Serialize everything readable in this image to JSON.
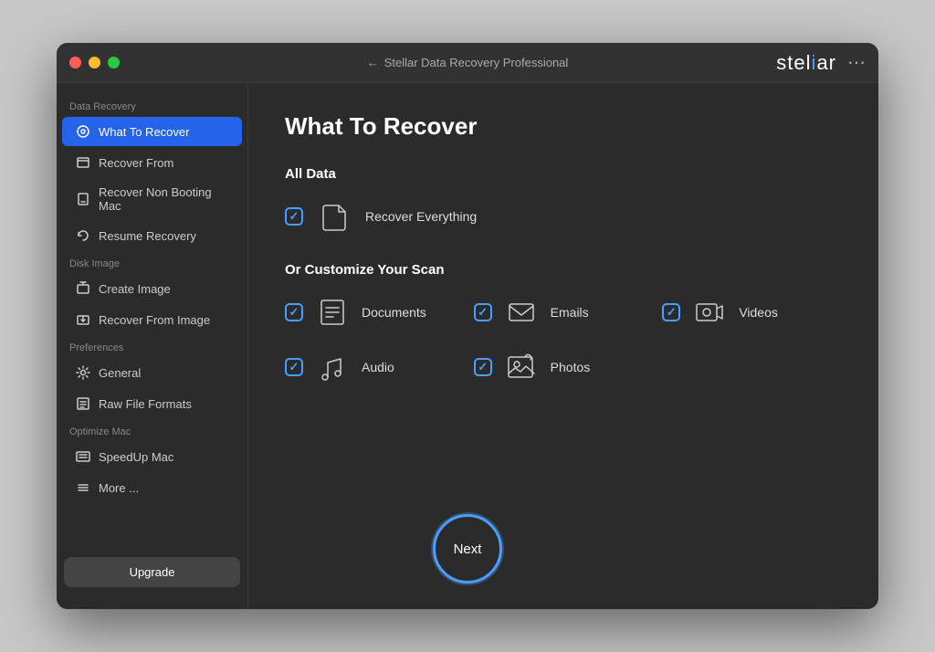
{
  "app": {
    "title": "Stellar Data Recovery Professional",
    "logo": "stellar",
    "logo_accent": "i"
  },
  "titlebar": {
    "back_icon": "←",
    "menu_icon": "⋯"
  },
  "sidebar": {
    "sections": [
      {
        "label": "Data Recovery",
        "items": [
          {
            "id": "what-to-recover",
            "label": "What To Recover",
            "active": true
          },
          {
            "id": "recover-from",
            "label": "Recover From",
            "active": false
          },
          {
            "id": "recover-non-booting",
            "label": "Recover Non Booting Mac",
            "active": false
          },
          {
            "id": "resume-recovery",
            "label": "Resume Recovery",
            "active": false
          }
        ]
      },
      {
        "label": "Disk Image",
        "items": [
          {
            "id": "create-image",
            "label": "Create Image",
            "active": false
          },
          {
            "id": "recover-from-image",
            "label": "Recover From Image",
            "active": false
          }
        ]
      },
      {
        "label": "Preferences",
        "items": [
          {
            "id": "general",
            "label": "General",
            "active": false
          },
          {
            "id": "raw-file-formats",
            "label": "Raw File Formats",
            "active": false
          }
        ]
      },
      {
        "label": "Optimize Mac",
        "items": [
          {
            "id": "speedup-mac",
            "label": "SpeedUp Mac",
            "active": false
          },
          {
            "id": "more",
            "label": "More ...",
            "active": false
          }
        ]
      }
    ],
    "upgrade_label": "Upgrade"
  },
  "main": {
    "page_title": "What To Recover",
    "all_data_label": "All Data",
    "recover_everything_label": "Recover Everything",
    "recover_everything_checked": true,
    "customize_label": "Or Customize Your Scan",
    "options": [
      {
        "id": "documents",
        "label": "Documents",
        "checked": true
      },
      {
        "id": "emails",
        "label": "Emails",
        "checked": true
      },
      {
        "id": "videos",
        "label": "Videos",
        "checked": true
      },
      {
        "id": "audio",
        "label": "Audio",
        "checked": true
      },
      {
        "id": "photos",
        "label": "Photos",
        "checked": true
      }
    ],
    "next_button_label": "Next"
  }
}
